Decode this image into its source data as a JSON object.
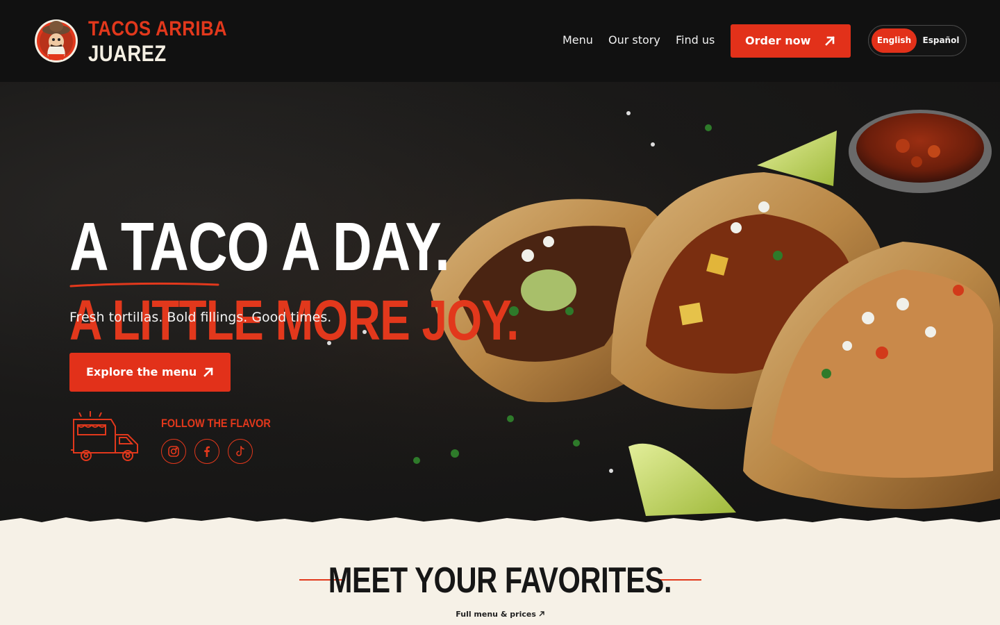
{
  "brand": {
    "name_top": "TACOS ARRIBA",
    "name_bottom": "JUAREZ"
  },
  "nav": {
    "links": [
      {
        "label": "Menu"
      },
      {
        "label": "Our story"
      },
      {
        "label": "Find us"
      }
    ],
    "order_button": "Order now",
    "languages": {
      "active": "English",
      "other": "Español"
    }
  },
  "hero": {
    "headline_line1": "A TACO A DAY.",
    "headline_line2": "A LITTLE MORE JOY.",
    "tagline": "Fresh tortillas. Bold fillings. Good times.",
    "cta_label": "Explore the menu",
    "follow_label": "FOLLOW THE FLAVOR",
    "social": [
      {
        "icon": "instagram-icon"
      },
      {
        "icon": "facebook-icon"
      },
      {
        "icon": "tiktok-icon"
      }
    ]
  },
  "favorites": {
    "title": "MEET YOUR FAVORITES.",
    "link_label": "Full menu & prices",
    "link_icon": "arrow-up-right-icon"
  },
  "colors": {
    "accent": "#e2311a",
    "header_bg": "#111111",
    "cream": "#f6f1e7"
  }
}
